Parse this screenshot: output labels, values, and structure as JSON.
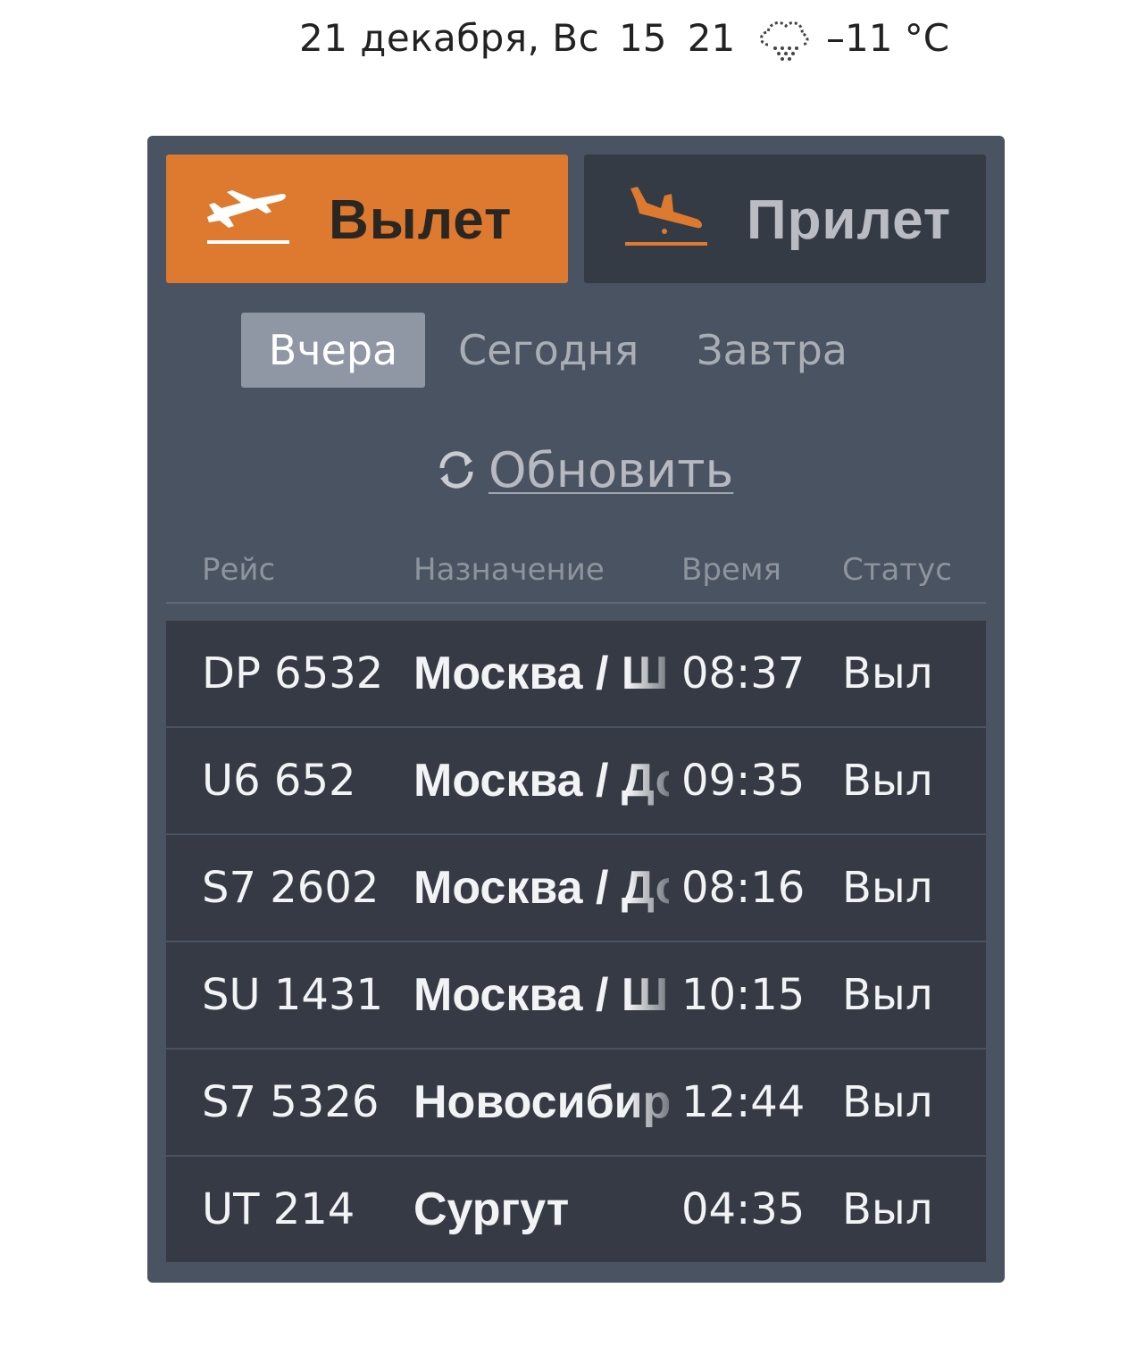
{
  "header": {
    "date": "21 декабря, Вс",
    "time": "15 21",
    "weather_icon": "cloud-snow-icon",
    "temperature": "–11 °C"
  },
  "direction_tabs": [
    {
      "label": "Вылет",
      "icon": "departure-plane-icon",
      "active": true
    },
    {
      "label": "Прилет",
      "icon": "arrival-plane-icon",
      "active": false
    }
  ],
  "day_tabs": [
    {
      "label": "Вчера",
      "active": true
    },
    {
      "label": "Сегодня",
      "active": false
    },
    {
      "label": "Завтра",
      "active": false
    }
  ],
  "refresh": {
    "label": "Обновить",
    "icon": "refresh-icon"
  },
  "table": {
    "columns": [
      "Рейс",
      "Назначение",
      "Время",
      "Статус"
    ],
    "rows": [
      {
        "flight": "DP 6532",
        "destination": "Москва / Ш",
        "time": "08:37",
        "status": "Выл"
      },
      {
        "flight": "U6 652",
        "destination": "Москва / До",
        "time": "09:35",
        "status": "Выл"
      },
      {
        "flight": "S7 2602",
        "destination": "Москва / До",
        "time": "08:16",
        "status": "Выл"
      },
      {
        "flight": "SU 1431",
        "destination": "Москва / Ш",
        "time": "10:15",
        "status": "Выл"
      },
      {
        "flight": "S7 5326",
        "destination": "Новосибир",
        "time": "12:44",
        "status": "Выл"
      },
      {
        "flight": "UT 214",
        "destination": "Сургут",
        "time": "04:35",
        "status": "Выл"
      }
    ]
  },
  "colors": {
    "accent": "#dd7a2f",
    "board_bg": "#4a5361",
    "row_bg": "#353a44",
    "active_day_bg": "#8f97a4"
  }
}
